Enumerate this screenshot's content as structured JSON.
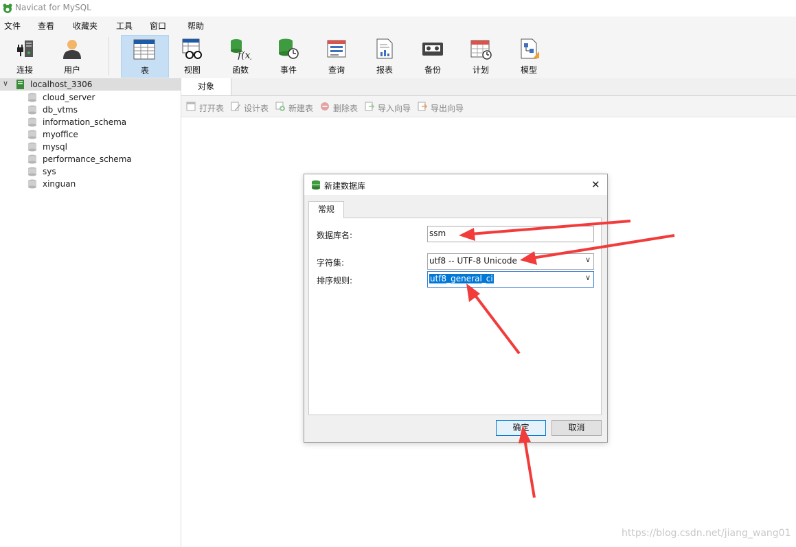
{
  "window": {
    "title": "Navicat for MySQL"
  },
  "menu": [
    "文件",
    "查看",
    "收藏夹",
    "工具",
    "窗口",
    "帮助"
  ],
  "toolbar": [
    {
      "label": "连接",
      "icon": "connection-plug-icon"
    },
    {
      "label": "用户",
      "icon": "user-icon"
    },
    {
      "label": "表",
      "icon": "table-icon",
      "selected": true
    },
    {
      "label": "视图",
      "icon": "view-glasses-icon"
    },
    {
      "label": "函数",
      "icon": "function-fx-icon"
    },
    {
      "label": "事件",
      "icon": "event-clock-icon"
    },
    {
      "label": "查询",
      "icon": "query-icon"
    },
    {
      "label": "报表",
      "icon": "report-icon"
    },
    {
      "label": "备份",
      "icon": "backup-tape-icon"
    },
    {
      "label": "计划",
      "icon": "schedule-calendar-icon"
    },
    {
      "label": "模型",
      "icon": "model-icon"
    }
  ],
  "sidebar": {
    "connection": "localhost_3306",
    "databases": [
      "cloud_server",
      "db_vtms",
      "information_schema",
      "myoffice",
      "mysql",
      "performance_schema",
      "sys",
      "xinguan"
    ]
  },
  "content": {
    "tab": "对象",
    "object_toolbar": [
      "打开表",
      "设计表",
      "新建表",
      "删除表",
      "导入向导",
      "导出向导"
    ]
  },
  "dialog": {
    "title": "新建数据库",
    "tab": "常规",
    "db_name_label": "数据库名:",
    "db_name_value": "ssm",
    "charset_label": "字符集:",
    "charset_value": "utf8 -- UTF-8 Unicode",
    "collation_label": "排序规则:",
    "collation_value": "utf8_general_ci",
    "ok": "确定",
    "cancel": "取消"
  },
  "watermark": "https://blog.csdn.net/jiang_wang01",
  "colors": {
    "selected_toolbar": "#c7dff4",
    "accent": "#0078d7",
    "annotation_arrow": "#f23b3b"
  }
}
